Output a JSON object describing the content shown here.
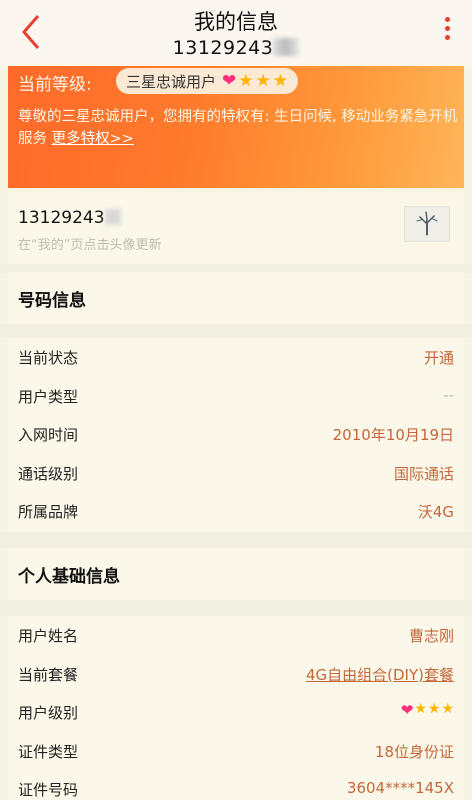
{
  "header": {
    "title": "我的信息",
    "phone_masked": "13129243"
  },
  "banner": {
    "level_label": "当前等级:",
    "level_name": "三星忠诚用户",
    "privilege_text": "尊敬的三星忠诚用户，您拥有的特权有: 生日问候, 移动业务紧急开机服务",
    "more_link": "更多特权>>"
  },
  "profile": {
    "phone_masked": "13129243",
    "hint": "在“我的”页点击头像更新"
  },
  "number_info": {
    "heading": "号码信息",
    "rows": [
      {
        "label": "当前状态",
        "value": "开通"
      },
      {
        "label": "用户类型",
        "value": "--"
      },
      {
        "label": "入网时间",
        "value": "2010年10月19日"
      },
      {
        "label": "通话级别",
        "value": "国际通话"
      },
      {
        "label": "所属品牌",
        "value": "沃4G"
      }
    ]
  },
  "personal_info": {
    "heading": "个人基础信息",
    "rows": [
      {
        "label": "用户姓名",
        "value": "曹志刚"
      },
      {
        "label": "当前套餐",
        "value": "4G自由组合(DIY)套餐"
      },
      {
        "label": "用户级别",
        "value": ""
      },
      {
        "label": "证件类型",
        "value": "18位身份证"
      },
      {
        "label": "证件号码",
        "value": "3604****145X"
      }
    ]
  },
  "colors": {
    "accent": "#ff7a2c",
    "value_text": "#c4673a",
    "back_arrow": "#e8402e"
  },
  "icons": [
    "back-arrow-icon",
    "more-vertical-icon",
    "heart-icon",
    "star-icon",
    "tree-avatar-icon"
  ]
}
